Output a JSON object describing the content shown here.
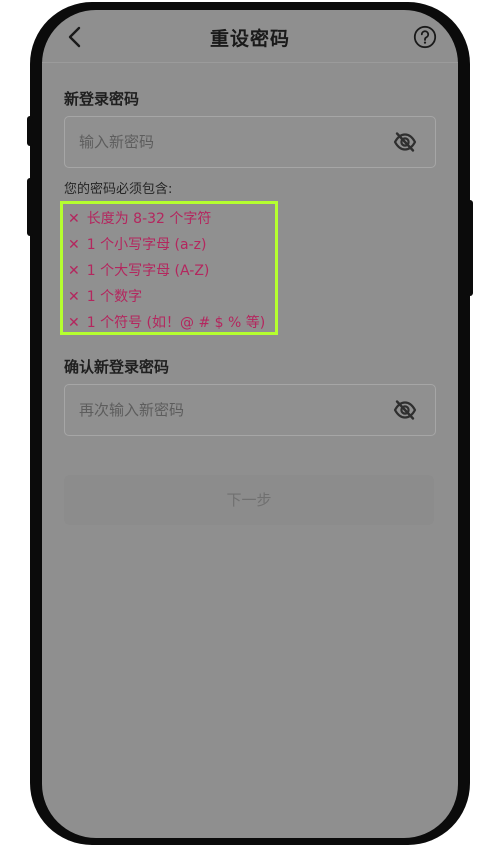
{
  "header": {
    "back_icon": "chevron-left-icon",
    "title": "重设密码",
    "help_icon": "question-circle-icon"
  },
  "new_password": {
    "label": "新登录密码",
    "placeholder": "输入新密码",
    "value": "",
    "visibility_icon": "eye-off-icon"
  },
  "requirements": {
    "title": "您的密码必须包含:",
    "mark": "✕",
    "items": [
      "长度为 8-32 个字符",
      "1 个小写字母 (a-z)",
      "1 个大写字母 (A-Z)",
      "1 个数字",
      "1 个符号 (如！@ # $ % 等)"
    ],
    "highlight_color": "#b5ff2f",
    "unmet_color": "#b4265e"
  },
  "confirm_password": {
    "label": "确认新登录密码",
    "placeholder": "再次输入新密码",
    "value": "",
    "visibility_icon": "eye-off-icon"
  },
  "next_button": {
    "label": "下一步"
  }
}
